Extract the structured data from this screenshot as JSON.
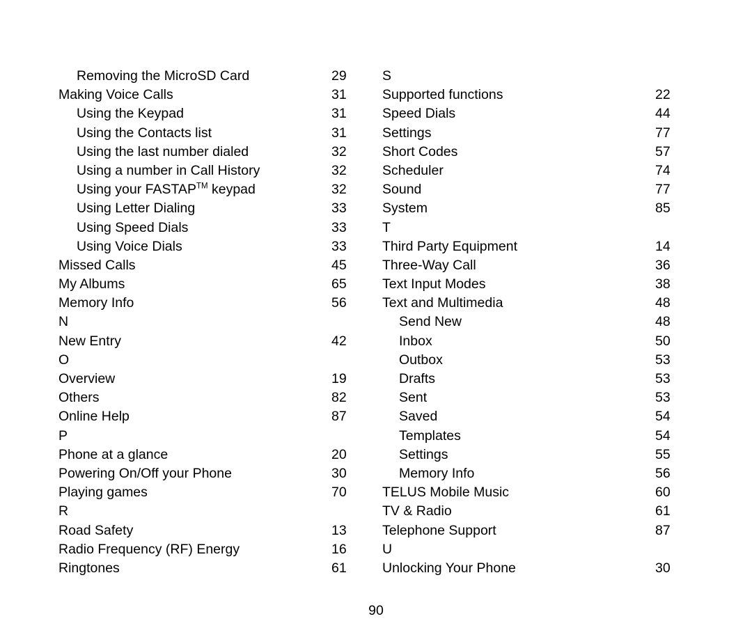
{
  "document": {
    "page_number": "90"
  },
  "left_column": {
    "entries": [
      {
        "kind": "entry",
        "level": 2,
        "title": "Removing the MicroSD Card",
        "page": "29"
      },
      {
        "kind": "entry",
        "level": 1,
        "title": "Making Voice Calls",
        "page": "31"
      },
      {
        "kind": "entry",
        "level": 2,
        "title": "Using the Keypad",
        "page": "31"
      },
      {
        "kind": "entry",
        "level": 2,
        "title": "Using the Contacts list",
        "page": "31"
      },
      {
        "kind": "entry",
        "level": 2,
        "title": "Using the last number dialed",
        "page": "32"
      },
      {
        "kind": "entry",
        "level": 2,
        "title": "Using a number in Call History",
        "page": "32"
      },
      {
        "kind": "entry_tm",
        "level": 2,
        "title_before": "Using your FASTAP",
        "superscript": "TM",
        "title_after": " keypad",
        "page": "32"
      },
      {
        "kind": "entry",
        "level": 2,
        "title": "Using Letter Dialing",
        "page": "33"
      },
      {
        "kind": "entry",
        "level": 2,
        "title": "Using Speed Dials",
        "page": "33"
      },
      {
        "kind": "entry",
        "level": 2,
        "title": "Using Voice Dials",
        "page": "33"
      },
      {
        "kind": "entry",
        "level": 1,
        "title": "Missed Calls",
        "page": "45"
      },
      {
        "kind": "entry",
        "level": 1,
        "title": "My Albums",
        "page": "65"
      },
      {
        "kind": "entry",
        "level": 1,
        "title": "Memory Info",
        "page": "56"
      },
      {
        "kind": "letter",
        "letter": "N"
      },
      {
        "kind": "entry",
        "level": 1,
        "title": "New Entry",
        "page": "42"
      },
      {
        "kind": "letter",
        "letter": "O"
      },
      {
        "kind": "entry",
        "level": 1,
        "title": "Overview",
        "page": "19"
      },
      {
        "kind": "entry",
        "level": 1,
        "title": "Others",
        "page": "82"
      },
      {
        "kind": "entry",
        "level": 1,
        "title": "Online Help",
        "page": "87"
      },
      {
        "kind": "letter",
        "letter": "P"
      },
      {
        "kind": "entry",
        "level": 1,
        "title": "Phone at a glance",
        "page": "20"
      },
      {
        "kind": "entry",
        "level": 1,
        "title": "Powering On/Off your Phone",
        "page": "30"
      },
      {
        "kind": "entry",
        "level": 1,
        "title": "Playing games",
        "page": "70"
      },
      {
        "kind": "letter",
        "letter": "R"
      },
      {
        "kind": "entry",
        "level": 1,
        "title": "Road Safety",
        "page": "13"
      },
      {
        "kind": "entry",
        "level": 1,
        "title": "Radio Frequency (RF) Energy",
        "page": "16"
      },
      {
        "kind": "entry",
        "level": 1,
        "title": "Ringtones",
        "page": "61"
      }
    ]
  },
  "right_column": {
    "entries": [
      {
        "kind": "letter",
        "letter": "S"
      },
      {
        "kind": "entry",
        "level": 1,
        "title": "Supported functions",
        "page": "22"
      },
      {
        "kind": "entry",
        "level": 1,
        "title": "Speed Dials",
        "page": "44"
      },
      {
        "kind": "entry",
        "level": 1,
        "title": "Settings",
        "page": "77"
      },
      {
        "kind": "entry",
        "level": 1,
        "title": "Short Codes",
        "page": "57"
      },
      {
        "kind": "entry",
        "level": 1,
        "title": "Scheduler",
        "page": "74"
      },
      {
        "kind": "entry",
        "level": 1,
        "title": "Sound",
        "page": "77"
      },
      {
        "kind": "entry",
        "level": 1,
        "title": "System",
        "page": "85"
      },
      {
        "kind": "letter",
        "letter": "T"
      },
      {
        "kind": "entry",
        "level": 1,
        "title": "Third Party Equipment",
        "page": "14"
      },
      {
        "kind": "entry",
        "level": 1,
        "title": "Three-Way Call",
        "page": "36"
      },
      {
        "kind": "entry",
        "level": 1,
        "title": "Text Input Modes",
        "page": "38"
      },
      {
        "kind": "entry",
        "level": 1,
        "title": "Text and Multimedia",
        "page": "48"
      },
      {
        "kind": "entry",
        "level": 2,
        "title": "Send New",
        "page": "48"
      },
      {
        "kind": "entry",
        "level": 2,
        "title": "Inbox",
        "page": "50"
      },
      {
        "kind": "entry",
        "level": 2,
        "title": "Outbox",
        "page": "53"
      },
      {
        "kind": "entry",
        "level": 2,
        "title": "Drafts",
        "page": "53"
      },
      {
        "kind": "entry",
        "level": 2,
        "title": "Sent",
        "page": "53"
      },
      {
        "kind": "entry",
        "level": 2,
        "title": "Saved",
        "page": "54"
      },
      {
        "kind": "entry",
        "level": 2,
        "title": "Templates",
        "page": "54"
      },
      {
        "kind": "entry",
        "level": 2,
        "title": "Settings",
        "page": "55"
      },
      {
        "kind": "entry",
        "level": 2,
        "title": "Memory Info",
        "page": "56"
      },
      {
        "kind": "entry",
        "level": 1,
        "title": "TELUS Mobile Music",
        "page": "60"
      },
      {
        "kind": "entry",
        "level": 1,
        "title": "TV & Radio",
        "page": "61"
      },
      {
        "kind": "entry",
        "level": 1,
        "title": "Telephone Support",
        "page": "87"
      },
      {
        "kind": "letter",
        "letter": "U"
      },
      {
        "kind": "entry",
        "level": 1,
        "title": "Unlocking Your Phone",
        "page": "30"
      }
    ]
  }
}
